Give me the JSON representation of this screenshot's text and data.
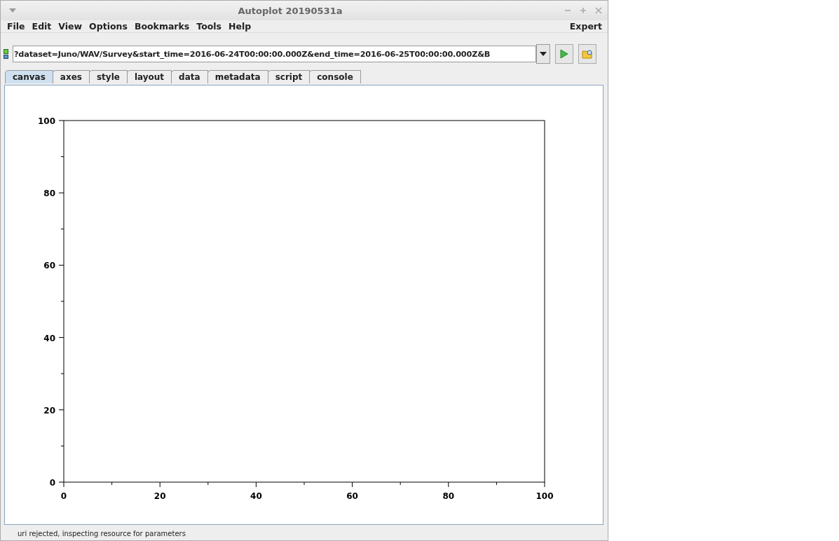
{
  "window": {
    "title": "Autoplot 20190531a"
  },
  "menu": [
    "File",
    "Edit",
    "View",
    "Options",
    "Bookmarks",
    "Tools",
    "Help"
  ],
  "menu_right": "Expert",
  "uri_field": {
    "value": "?dataset=Juno/WAV/Survey&start_time=2016-06-24T00:00:00.000Z&end_time=2016-06-25T00:00:00.000Z&B"
  },
  "tabs": [
    {
      "label": "canvas",
      "selected": true
    },
    {
      "label": "axes",
      "selected": false
    },
    {
      "label": "style",
      "selected": false
    },
    {
      "label": "layout",
      "selected": false
    },
    {
      "label": "data",
      "selected": false
    },
    {
      "label": "metadata",
      "selected": false
    },
    {
      "label": "script",
      "selected": false
    },
    {
      "label": "console",
      "selected": false
    }
  ],
  "canvas": {
    "chart_data": {
      "type": "line",
      "xlim": [
        0,
        100
      ],
      "ylim": [
        0,
        100
      ],
      "xticks": [
        0,
        20,
        40,
        60,
        80,
        100
      ],
      "yticks": [
        0,
        20,
        40,
        60,
        80,
        100
      ]
    }
  },
  "status_bar": "uri rejected, inspecting resource for parameters"
}
